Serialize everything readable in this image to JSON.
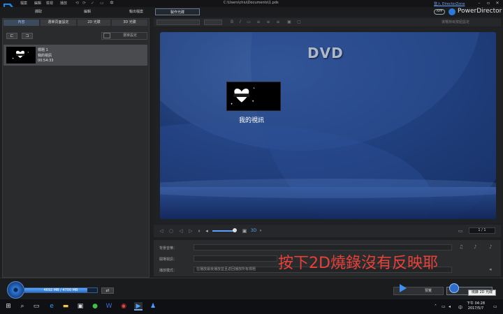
{
  "menu": {
    "file": "檔案",
    "edit": "編輯",
    "view": "檢視",
    "play": "播放"
  },
  "window": {
    "path": "C:\\Users\\chiu\\Documents\\1.pds"
  },
  "modes": {
    "capture": "擷取",
    "edit": "編輯",
    "output": "輸出檔案",
    "produce": "製作光碟"
  },
  "header": {
    "directorzone": "登入 DirectorZone",
    "app_badge": "APP",
    "product_name": "PowerDirector"
  },
  "left_tabs": {
    "content": "內容",
    "menu_design": "選單頁面設定",
    "disc2d": "2D 光碟",
    "disc3d": "3D 光碟"
  },
  "left_panel": {
    "select_menu": "選單設定",
    "item": {
      "title": "標題 1",
      "subtitle": "我的視訊",
      "duration": "00:54:33"
    }
  },
  "toolbar": {
    "right_label": "導覽節目按鈕設定"
  },
  "preview": {
    "dvd_label": "DVD",
    "menu_item_label": "我的視訊"
  },
  "playback": {
    "page": "1 / 1"
  },
  "settings": {
    "label1": "背景音樂：",
    "label2": "開場視訊：",
    "label3": "播放模式：",
    "mode_value": "在播放最後播放並且返回播放所有標題"
  },
  "annotation": "按下2D燒錄沒有反映耶",
  "bottom": {
    "capacity": "4692 MB / 4700 MB",
    "preview_button": "預覽",
    "burn_tooltip": "燒錄 2D 光碟"
  },
  "taskbar": {
    "time": "下午 04:28",
    "date": "2017/5/7",
    "ime": "中"
  },
  "colors": {
    "accent": "#2d7bd8",
    "annotation": "#e8413a"
  }
}
